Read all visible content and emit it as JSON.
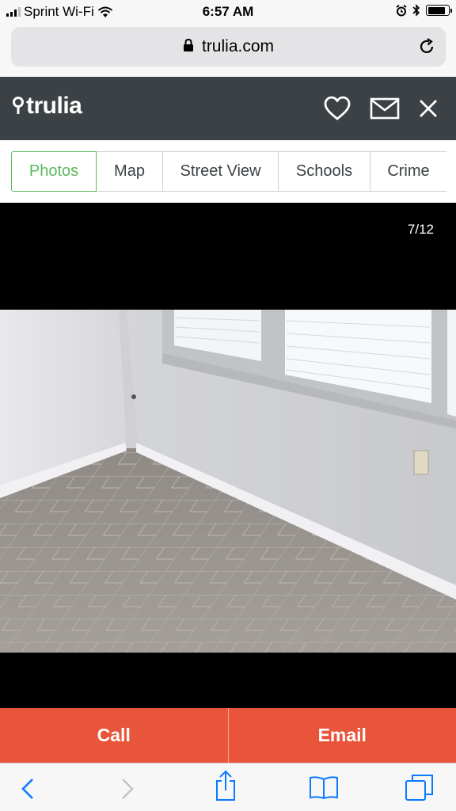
{
  "status_bar": {
    "carrier": "Sprint Wi-Fi",
    "time": "6:57 AM",
    "battery_level": 0.85,
    "icons": [
      "signal-icon",
      "wifi-icon",
      "alarm-icon",
      "bluetooth-icon",
      "battery-icon"
    ]
  },
  "browser": {
    "url": "trulia.com",
    "icons": [
      "lock-icon",
      "reload-icon"
    ]
  },
  "site_header": {
    "logo": "trulia",
    "icons": [
      "heart-icon",
      "mail-icon",
      "close-icon"
    ],
    "background": "#3b4144"
  },
  "tabs": [
    {
      "label": "Photos",
      "active": true
    },
    {
      "label": "Map",
      "active": false
    },
    {
      "label": "Street View",
      "active": false
    },
    {
      "label": "Schools",
      "active": false
    },
    {
      "label": "Crime",
      "active": false
    }
  ],
  "gallery": {
    "counter": "7/12"
  },
  "actions": {
    "call_label": "Call",
    "email_label": "Email",
    "color": "#e8553a"
  },
  "toolbar": {
    "icons": [
      "back-icon",
      "forward-icon",
      "share-icon",
      "bookmarks-icon",
      "tabs-icon"
    ],
    "accent": "#0a7aff"
  },
  "colors": {
    "accent_green": "#5cb85c"
  }
}
